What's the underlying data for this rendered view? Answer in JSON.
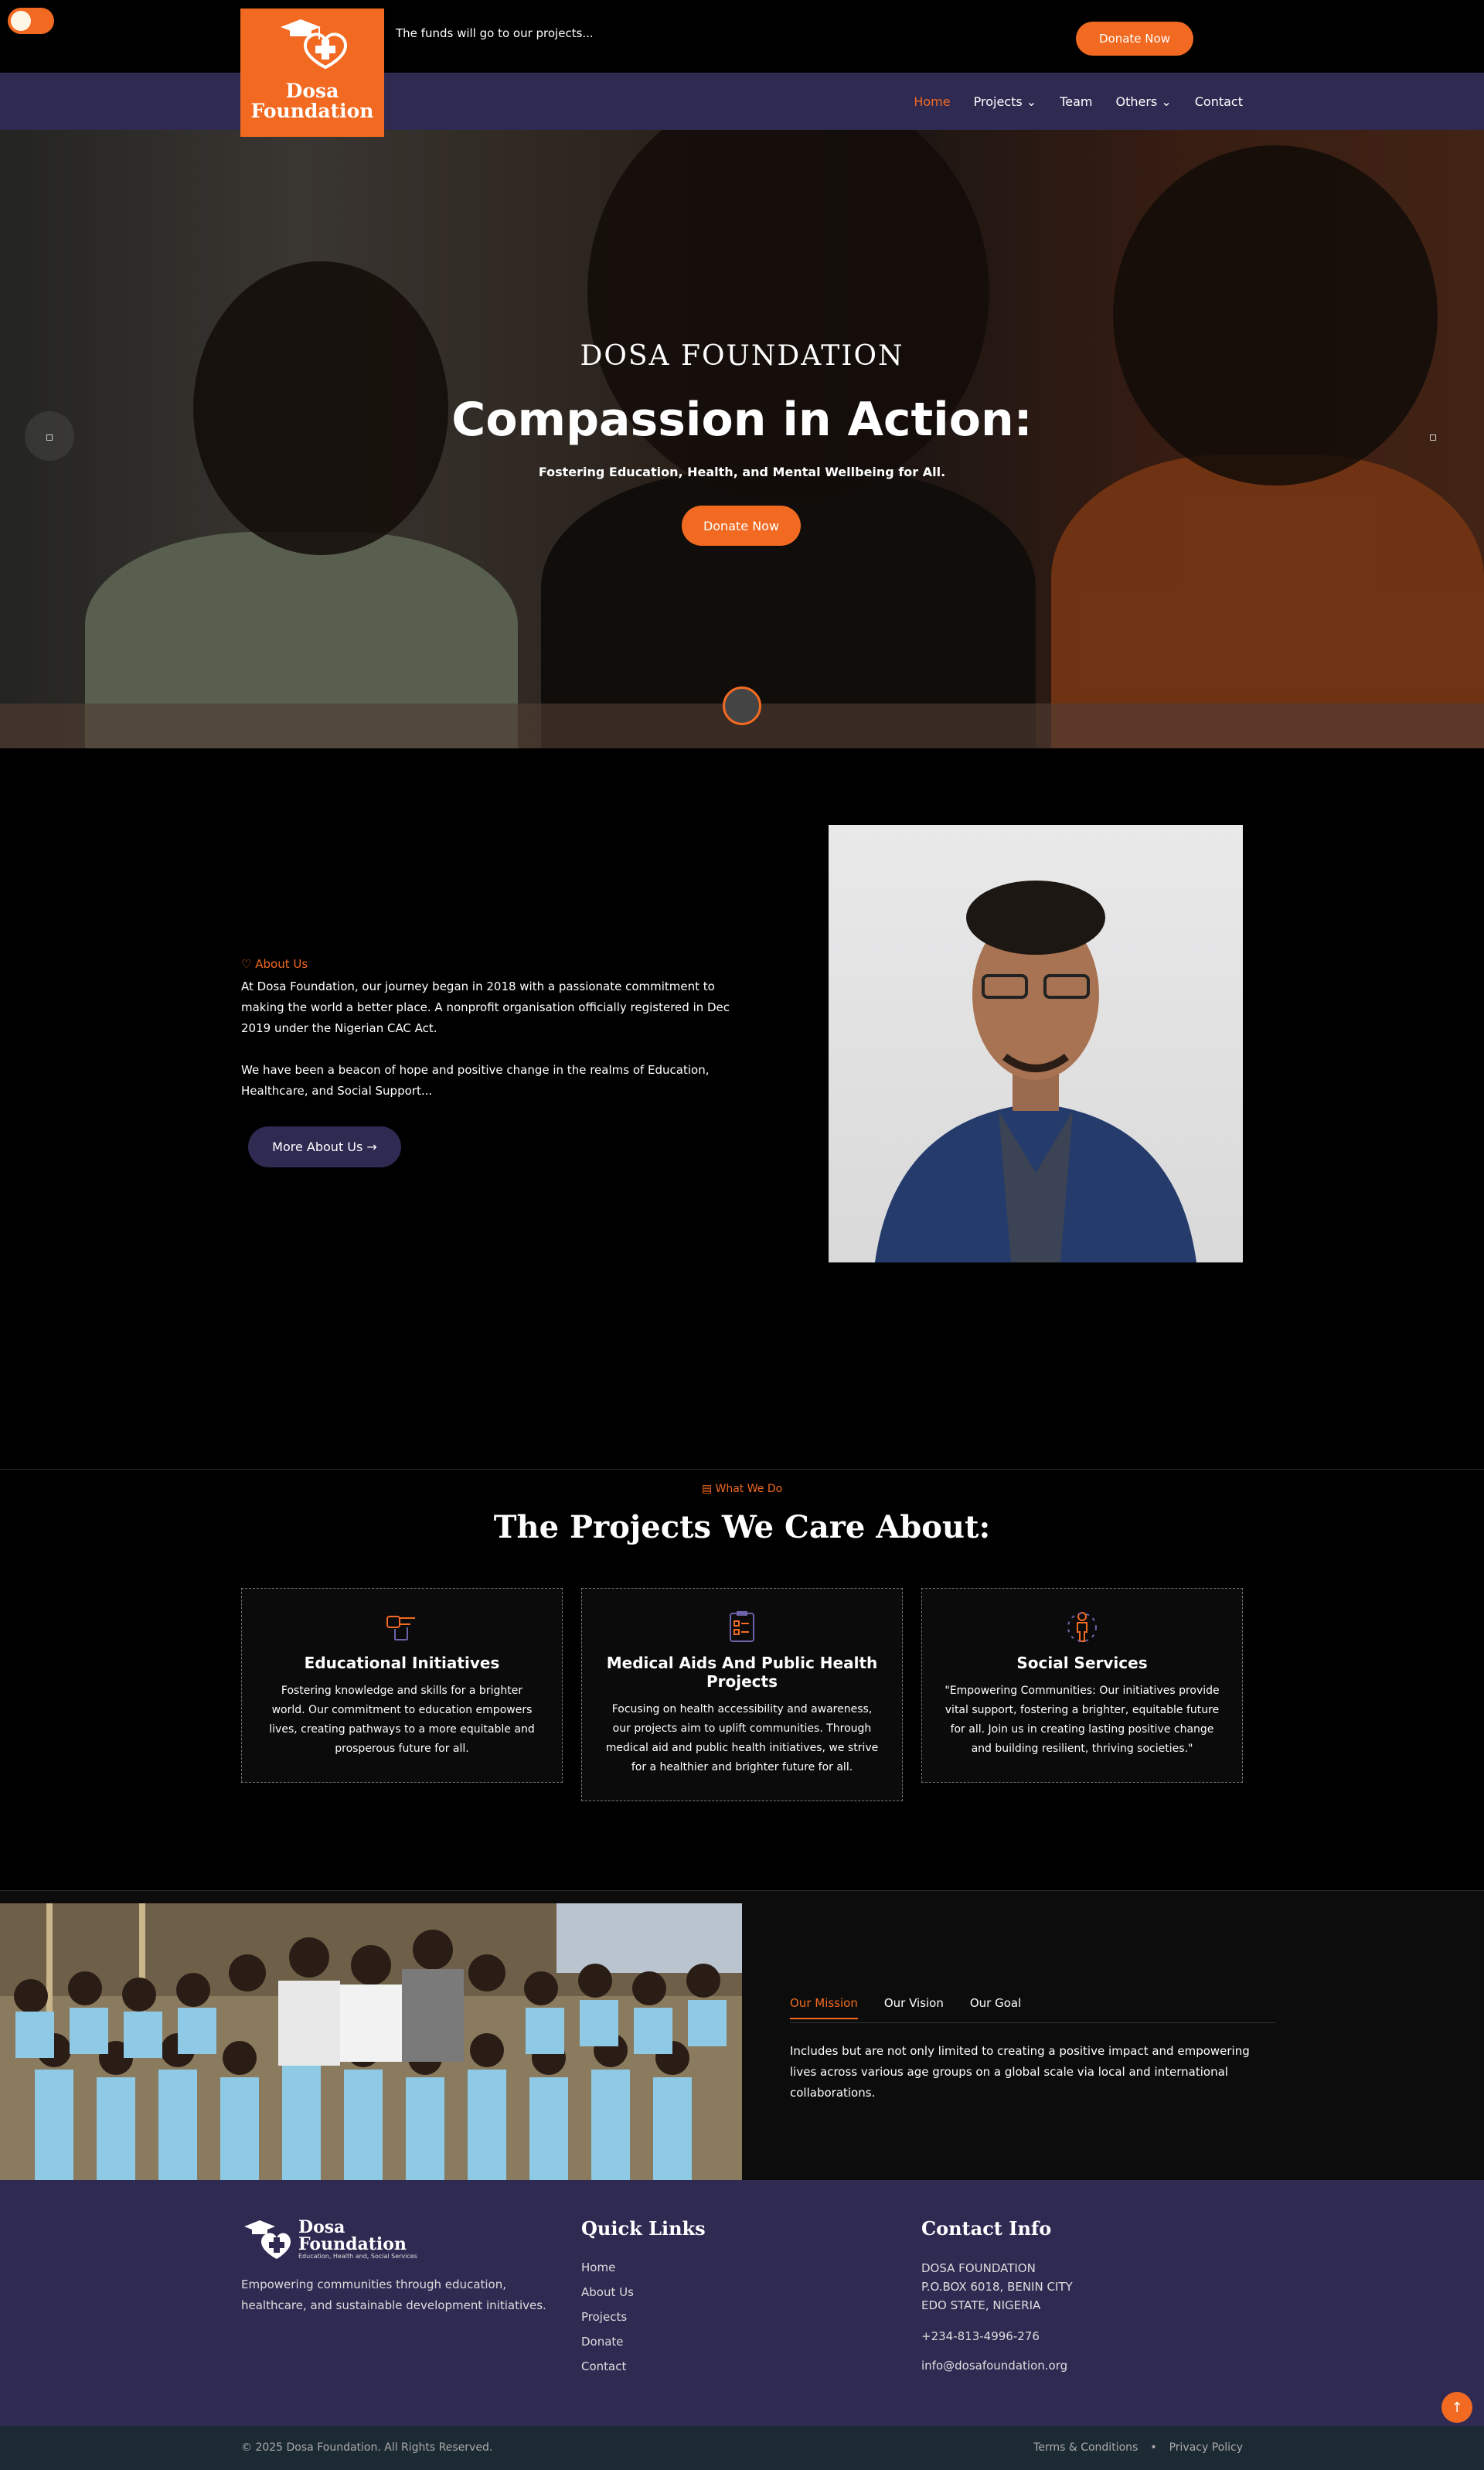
{
  "header": {
    "logo_line1": "Dosa",
    "logo_line2": "Foundation",
    "tagline": "The funds will go to our projects...",
    "donate_label": "Donate Now"
  },
  "nav": {
    "items": [
      {
        "label": "Home",
        "active": true
      },
      {
        "label": "Projects",
        "dropdown": true
      },
      {
        "label": "Team"
      },
      {
        "label": "Others",
        "dropdown": true
      },
      {
        "label": "Contact"
      }
    ]
  },
  "hero": {
    "eyebrow": "DOSA FOUNDATION",
    "title": "Compassion in Action:",
    "subtitle": "Fostering Education, Health, and Mental Wellbeing for All.",
    "cta": "Donate Now",
    "prev_icon": "chevron-left-icon",
    "next_icon": "chevron-right-icon"
  },
  "about": {
    "label": "About Us",
    "p1": "At Dosa Foundation, our journey began in 2018 with a passionate commitment to making the world a better place. A nonprofit organisation officially registered in Dec 2019 under the Nigerian CAC Act.",
    "p2": "We have been a beacon of hope and positive change in the realms of Education, Healthcare, and Social Support...",
    "button": "More About Us →"
  },
  "what_we_do": {
    "label": "What We Do",
    "title": "The Projects We Care About:",
    "cards": [
      {
        "icon": "teaching-icon",
        "title": "Educational Initiatives",
        "text": "Fostering knowledge and skills for a brighter world. Our commitment to education empowers lives, creating pathways to a more equitable and prosperous future for all."
      },
      {
        "icon": "clipboard-icon",
        "title": "Medical Aids And Public Health Projects",
        "text": "Focusing on health accessibility and awareness, our projects aim to uplift communities. Through medical aid and public health initiatives, we strive for a healthier and brighter future for all."
      },
      {
        "icon": "person-icon",
        "title": "Social Services",
        "text": "\"Empowering Communities: Our initiatives provide vital support, fostering a brighter, equitable future for all. Join us in creating lasting positive change and building resilient, thriving societies.\""
      }
    ]
  },
  "mission": {
    "tabs": [
      "Our Mission",
      "Our Vision",
      "Our Goal"
    ],
    "active_tab": "Our Mission",
    "text": "Includes but are not only limited to creating a positive impact and empowering lives across various age groups on a global scale via local and international collaborations."
  },
  "footer": {
    "logo_line1": "Dosa",
    "logo_line2": "Foundation",
    "logo_small": "Education, Health and, Social Services",
    "description": "Empowering communities through education, healthcare, and sustainable development initiatives.",
    "quick_links_title": "Quick Links",
    "quick_links": [
      "Home",
      "About Us",
      "Projects",
      "Donate",
      "Contact"
    ],
    "contact_title": "Contact Info",
    "address1": "DOSA FOUNDATION",
    "address2": "P.O.BOX 6018, BENIN CITY",
    "address3": "EDO STATE, NIGERIA",
    "phone": "+234-813-4996-276",
    "email": "info@dosafoundation.org",
    "copyright": "© 2025 Dosa Foundation. All Rights Reserved.",
    "terms": "Terms & Conditions",
    "privacy": "Privacy Policy"
  },
  "colors": {
    "accent": "#f26a21",
    "navy": "#2f2a52",
    "dark": "#000000"
  }
}
